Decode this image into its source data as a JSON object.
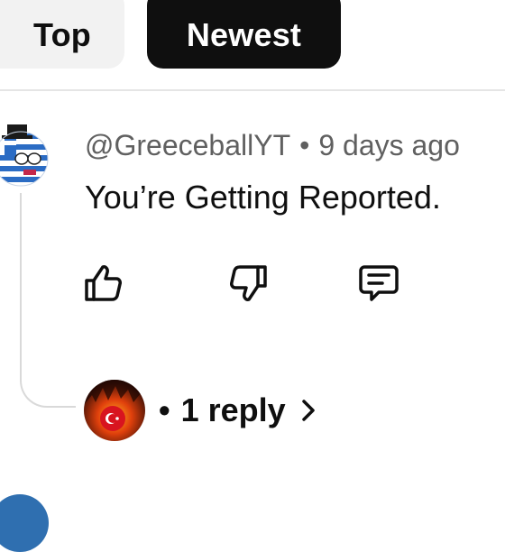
{
  "filters": {
    "top_label": "Top",
    "newest_label": "Newest",
    "selected": "Newest"
  },
  "comment": {
    "author": "@GreeceballYT",
    "separator": "•",
    "time": "9 days ago",
    "text": "You’re Getting Reported.",
    "avatar_icon": "greece-countryball-avatar",
    "actions": {
      "like_icon": "thumbs-up-icon",
      "dislike_icon": "thumbs-down-icon",
      "reply_icon": "comment-reply-icon"
    }
  },
  "replies": {
    "bullet": "•",
    "label": "1 reply",
    "reply_avatar_icon": "turkey-countryball-fire-avatar",
    "chevron_icon": "chevron-right-icon"
  },
  "colors": {
    "chip_selected_bg": "#0f0f0f",
    "chip_bg": "#f2f2f2",
    "meta_text": "#606060",
    "thread_line": "#d9d9d9"
  }
}
